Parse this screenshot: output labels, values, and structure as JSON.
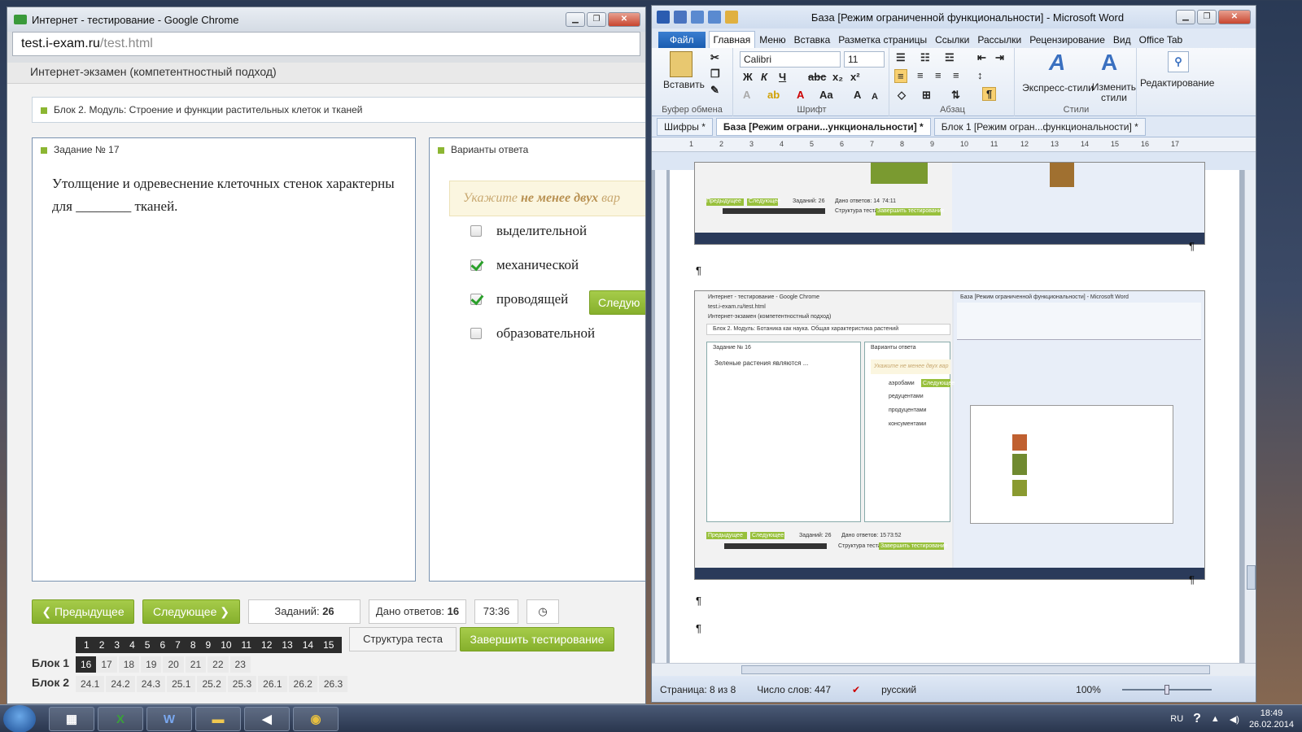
{
  "chrome": {
    "title": "Интернет - тестирование - Google Chrome",
    "url_host": "test.i-exam.ru",
    "url_path": "/test.html",
    "header": "Интернет-экзамен (компетентностный подход)",
    "block_title": "Блок 2. Модуль: Строение и функции растительных клеток и тканей",
    "task_label": "Задание № 17",
    "task_text": "Утолщение и одревеснение клеточных стенок характерны для ________ тканей.",
    "answers_label": "Варианты ответа",
    "hint_prefix": "Укажите",
    "hint_bold": "не менее двух",
    "hint_suffix": "вар",
    "options": [
      {
        "label": "выделительной",
        "checked": false
      },
      {
        "label": "механической",
        "checked": true
      },
      {
        "label": "проводящей",
        "checked": true
      },
      {
        "label": "образовательной",
        "checked": false
      }
    ],
    "next_inline": "Следую",
    "prev_button": "Предыдущее",
    "next_button": "Следующее",
    "tasks_label": "Заданий:",
    "tasks_count": "26",
    "answered_label": "Дано ответов:",
    "answered_count": "16",
    "timer": "73:36",
    "structure_button": "Структура теста",
    "finish_button": "Завершить тестирование",
    "block1_label": "Блок 1",
    "block2_label": "Блок 2",
    "block1_numbers": [
      "1",
      "2",
      "3",
      "4",
      "5",
      "6",
      "7",
      "8",
      "9",
      "10",
      "11",
      "12",
      "13",
      "14",
      "15"
    ],
    "block1_row2": [
      "16",
      "17",
      "18",
      "19",
      "20",
      "21",
      "22",
      "23"
    ],
    "block2_numbers": [
      "24.1",
      "24.2",
      "24.3",
      "25.1",
      "25.2",
      "25.3",
      "26.1",
      "26.2",
      "26.3"
    ]
  },
  "word": {
    "title": "База [Режим ограниченной функциональности]  -  Microsoft Word",
    "file_tab": "Файл",
    "tabs": [
      "Главная",
      "Меню",
      "Вставка",
      "Разметка страницы",
      "Ссылки",
      "Рассылки",
      "Рецензирование",
      "Вид",
      "Office Tab"
    ],
    "ribbon": {
      "paste": "Вставить",
      "clipboard": "Буфер обмена",
      "font_name": "Calibri",
      "font_size": "11",
      "font_group": "Шрифт",
      "paragraph_group": "Абзац",
      "styles_express": "Экспресс-стили",
      "styles_change": "Изменить стили",
      "styles_group": "Стили",
      "editing": "Редактирование"
    },
    "doc_tabs": [
      "Шифры *",
      "База [Режим ограни...ункциональности] *",
      "Блок 1 [Режим огран...функциональности] *"
    ],
    "ruler_marks": [
      "1",
      "2",
      "3",
      "4",
      "5",
      "6",
      "7",
      "8",
      "9",
      "10",
      "11",
      "12",
      "13",
      "14",
      "15",
      "16",
      "17"
    ],
    "paragraph_mark": "¶",
    "status": {
      "page": "Страница: 8 из 8",
      "words": "Число слов: 447",
      "lang": "русский",
      "zoom": "100%"
    },
    "thumb": {
      "title_chrome": "Интернет - тестирование - Google Chrome",
      "url": "test.i-exam.ru/test.html",
      "header": "Интернет-экзамен (компетентностный подход)",
      "block": "Блок 2. Модуль: Ботаника как наука. Общая характеристика растений",
      "task": "Задание № 16",
      "answers": "Варианты ответа",
      "question": "Зеленые растения являются ...",
      "hint": "Укажите не менее двух вар",
      "opts": [
        "аэробами",
        "редуцентами",
        "продуцентами",
        "консументами"
      ],
      "next": "Следующее",
      "prev": "Предыдущее",
      "tasks": "Заданий: 26",
      "answered": "Дано ответов: 15",
      "timer": "73:52",
      "structure": "Структура теста",
      "finish": "Завершить тестирование",
      "word_title": "База [Режим ограниченной функциональности] - Microsoft Word",
      "answered_top": "Дано ответов: 14",
      "timer_top": "74:11"
    }
  },
  "taskbar": {
    "lang": "RU",
    "time": "18:49",
    "date": "26.02.2014"
  }
}
